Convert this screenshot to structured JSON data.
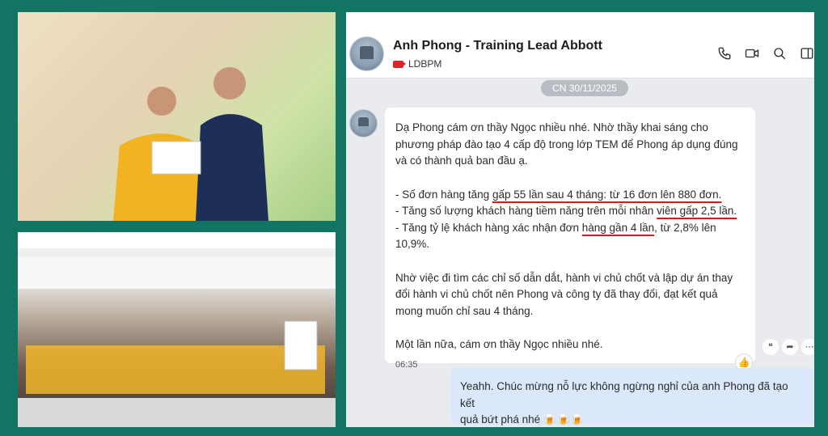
{
  "chat": {
    "title": "Anh Phong - Training Lead Abbott",
    "subtitle": "LDBPM",
    "date_chip": "CN 30/11/2025",
    "header_icons": [
      "phone-icon",
      "video-icon",
      "search-icon",
      "sidebar-icon"
    ],
    "incoming_message": {
      "line1": "Dạ Phong cám ơn thầy Ngọc nhiều nhé. Nhờ thầy khai sáng cho",
      "line2": "phương pháp đào tạo 4 cấp độ trong lớp TEM để Phong áp dụng đúng",
      "line3": "và có thành quả ban đầu ạ.",
      "bullet1_pre": "- Số đơn hàng tăng ",
      "bullet1_ul": "gấp 55 lần sau 4 tháng: từ 16 đơn lên 880 đơn.",
      "bullet2_pre": "- Tăng số lượng khách hàng tiềm năng trên mỗi nhân ",
      "bullet2_ul": "viên gấp 2,5 lần.",
      "bullet3_pre": "- Tăng tỷ lệ khách hàng xác nhận đơn ",
      "bullet3_ul": "hàng gần 4 lần",
      "bullet3_post": ", từ 2,8% lên 10,9%.",
      "para2_line1": "Nhờ việc đi tìm các chỉ số dẫn dắt, hành vi chủ chốt và lập dự án thay",
      "para2_line2": "đổi hành vi chủ chốt nên Phong và công ty đã thay đổi, đạt kết quả",
      "para2_line3": "mong muốn chỉ sau 4 tháng.",
      "closing": "Một lần nữa, cám ơn thầy Ngọc nhiều nhé.",
      "time": "06:35"
    },
    "outgoing_message": {
      "line1": "Yeahh. Chúc mừng nỗ lực không ngừng nghỉ của anh Phong đã tạo kết",
      "line2": "quả bứt phá nhé 🍺🍺🍺"
    }
  },
  "colors": {
    "frame": "#127563",
    "underline": "#e1161d",
    "outgoing_bubble": "#dbe8fb",
    "chat_bg": "#eaebee"
  }
}
